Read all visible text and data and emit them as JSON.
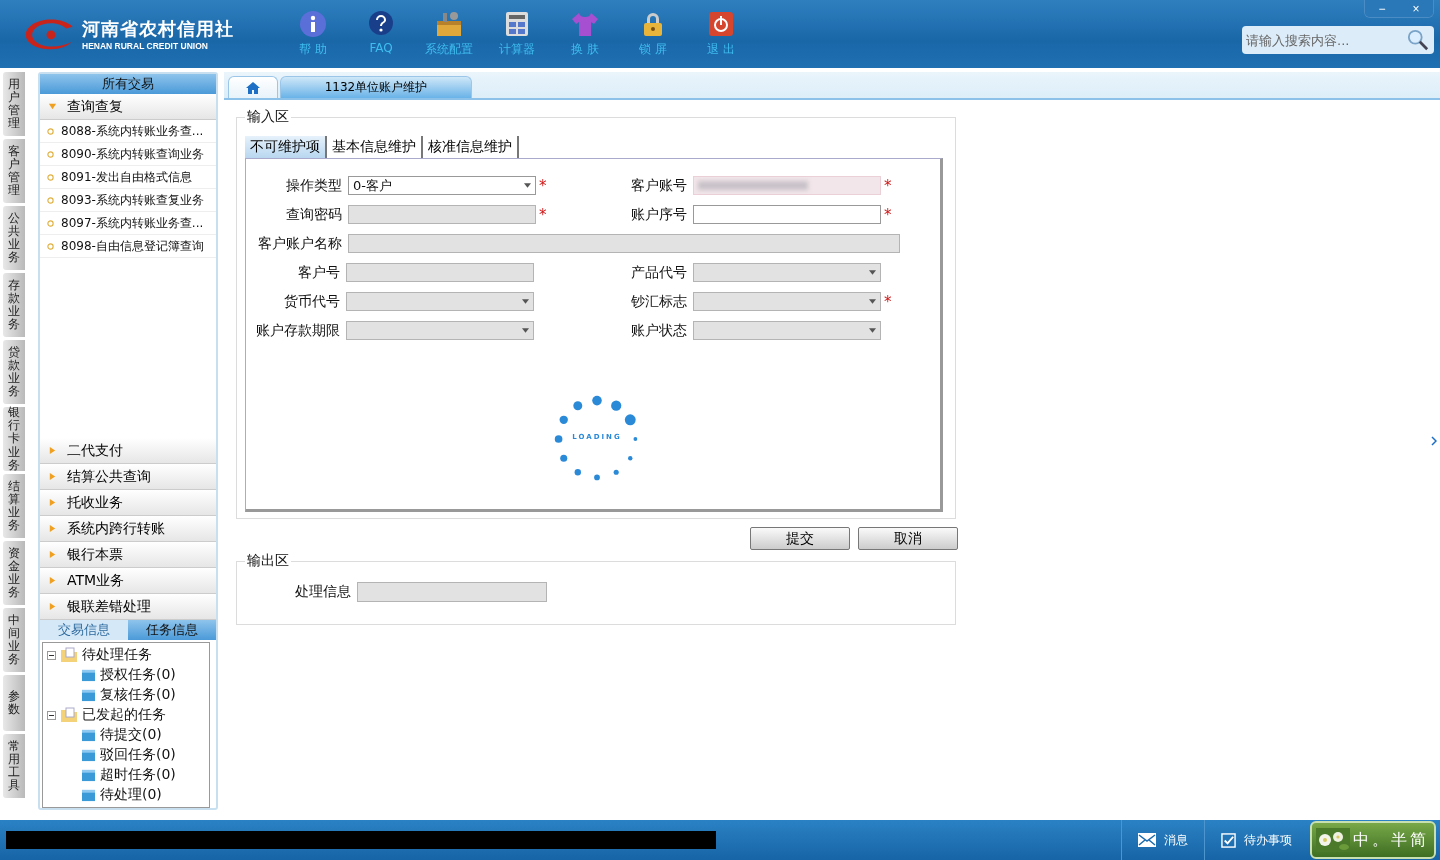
{
  "header": {
    "logo_title": "河南省农村信用社",
    "logo_subtitle": "HENAN RURAL CREDIT UNION",
    "toolbar": [
      {
        "label": "帮 助"
      },
      {
        "label": "FAQ"
      },
      {
        "label": "系统配置"
      },
      {
        "label": "计算器"
      },
      {
        "label": "换 肤"
      },
      {
        "label": "锁 屏"
      },
      {
        "label": "退 出"
      }
    ],
    "window_controls": [
      "−",
      "×"
    ],
    "search": {
      "placeholder": "请输入搜索内容..."
    }
  },
  "side_tabs": [
    "用户管理",
    "客户管理",
    "公共业务",
    "存款业务",
    "贷款业务",
    "银行卡业务",
    "结算业务",
    "资金业务",
    "中间业务",
    "参数",
    "常用工具"
  ],
  "sidebar": {
    "title": "所有交易",
    "groups": [
      {
        "label": "查询查复",
        "expanded": true,
        "items": [
          "8088-系统内转账业务查...",
          "8090-系统内转账查询业务",
          "8091-发出自由格式信息",
          "8093-系统内转账查复业务",
          "8097-系统内转账业务查...",
          "8098-自由信息登记簿查询"
        ]
      },
      {
        "label": "二代支付",
        "expanded": false
      },
      {
        "label": "结算公共查询",
        "expanded": false
      },
      {
        "label": "托收业务",
        "expanded": false
      },
      {
        "label": "系统内跨行转账",
        "expanded": false
      },
      {
        "label": "银行本票",
        "expanded": false
      },
      {
        "label": "ATM业务",
        "expanded": false
      },
      {
        "label": "银联差错处理",
        "expanded": false
      }
    ],
    "info_tabs": [
      {
        "label": "交易信息",
        "selected": false
      },
      {
        "label": "任务信息",
        "selected": true
      }
    ],
    "tree": [
      {
        "label": "待处理任务",
        "expanded": true,
        "children": [
          {
            "label": "授权任务(0)"
          },
          {
            "label": "复核任务(0)"
          }
        ]
      },
      {
        "label": "已发起的任务",
        "expanded": true,
        "children": [
          {
            "label": "待提交(0)"
          },
          {
            "label": "驳回任务(0)"
          },
          {
            "label": "超时任务(0)"
          },
          {
            "label": "待处理(0)"
          }
        ]
      }
    ]
  },
  "page_tabs": [
    {
      "kind": "home",
      "selected": false
    },
    {
      "kind": "text",
      "label": "1132单位账户维护",
      "selected": true
    }
  ],
  "input_area": {
    "legend": "输入区",
    "tabs": [
      {
        "label": "不可维护项",
        "selected": true
      },
      {
        "label": "基本信息维护",
        "selected": false
      },
      {
        "label": "核准信息维护",
        "selected": false
      }
    ],
    "fields": [
      {
        "label": "操作类型",
        "kind": "select",
        "disabled": false,
        "required_mark": "*",
        "value": "0-客户"
      },
      {
        "label": "客户账号",
        "kind": "input",
        "disabled": false,
        "required_mark": "*",
        "redacted": true
      },
      {
        "label": "查询密码",
        "kind": "input",
        "disabled": true,
        "required_mark": "*"
      },
      {
        "label": "账户序号",
        "kind": "input",
        "disabled": false,
        "required_mark": "*"
      },
      {
        "label": "客户账户名称",
        "kind": "wide",
        "disabled": true
      },
      {
        "label": "客户号",
        "kind": "input",
        "disabled": true
      },
      {
        "label": "产品代号",
        "kind": "select",
        "disabled": true
      },
      {
        "label": "货币代号",
        "kind": "select",
        "disabled": true
      },
      {
        "label": "钞汇标志",
        "kind": "select",
        "disabled": true,
        "required_mark": "*"
      },
      {
        "label": "账户存款期限",
        "kind": "select",
        "disabled": true
      },
      {
        "label": "账户状态",
        "kind": "select",
        "disabled": true
      }
    ],
    "loading": "LOADING"
  },
  "buttons": [
    "提交",
    "取消"
  ],
  "output_area": {
    "legend": "输出区",
    "fields": [
      {
        "label": "处理信息",
        "disabled": true
      }
    ]
  },
  "status_bar": {
    "redacted": true,
    "items": [
      {
        "label": "消息",
        "kind": "mail"
      },
      {
        "label": "待办事项",
        "kind": "todo"
      }
    ],
    "ime": [
      "中",
      "。",
      "半",
      "简"
    ]
  }
}
